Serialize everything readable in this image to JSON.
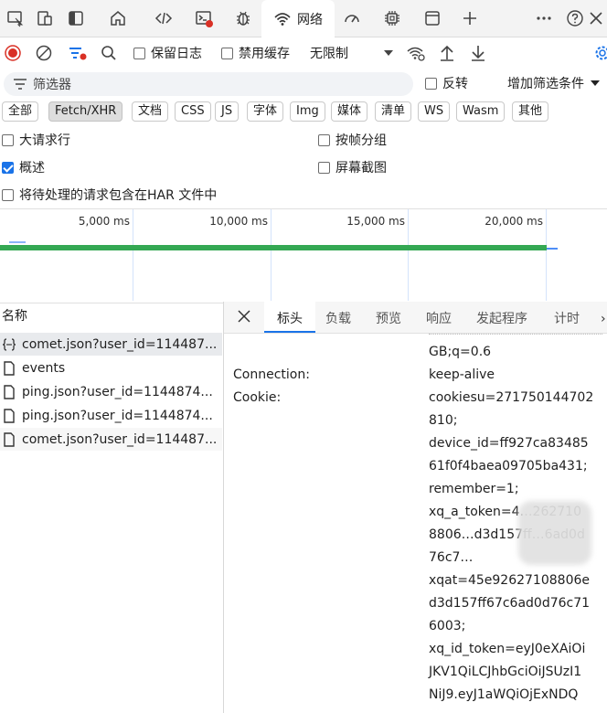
{
  "tabbar": {
    "network_label": "网络",
    "icons": [
      "inspect-icon",
      "device-emulation-icon",
      "sidebar-toggle-icon",
      "home-icon",
      "sources-icon",
      "console-icon",
      "debugger-icon",
      "network-icon",
      "performance-icon",
      "memory-icon",
      "application-icon",
      "add-tool-icon",
      "more-icon",
      "help-icon"
    ]
  },
  "toolbar": {
    "preserve_log": "保留日志",
    "disable_cache": "禁用缓存",
    "throttle": "无限制"
  },
  "filter": {
    "placeholder": "筛选器",
    "invert": "反转",
    "more_filters": "增加筛选条件"
  },
  "types": [
    "全部",
    "Fetch/XHR",
    "文档",
    "CSS",
    "JS",
    "字体",
    "Img",
    "媒体",
    "清单",
    "WS",
    "Wasm",
    "其他"
  ],
  "active_type": "Fetch/XHR",
  "options": {
    "big_rows": "大请求行",
    "group_by_frame": "按帧分组",
    "overview": "概述",
    "screenshots": "屏幕截图",
    "har_include": "将待处理的请求包含在HAR 文件中"
  },
  "timeline": {
    "ticks": [
      "5,000 ms",
      "10,000 ms",
      "15,000 ms",
      "20,000 ms"
    ]
  },
  "requests": {
    "header": "名称",
    "items": [
      {
        "name": "comet.json?user_id=114487...",
        "icon": "fetch-icon"
      },
      {
        "name": "events",
        "icon": "document-icon"
      },
      {
        "name": "ping.json?user_id=1144874...",
        "icon": "document-icon"
      },
      {
        "name": "ping.json?user_id=1144874...",
        "icon": "document-icon"
      },
      {
        "name": "comet.json?user_id=114487...",
        "icon": "document-icon"
      }
    ]
  },
  "details": {
    "tabs": [
      "标头",
      "负载",
      "预览",
      "响应",
      "发起程序",
      "计时"
    ],
    "active_tab": "标头",
    "partial_top_line": "GB;q=0.6",
    "headers": [
      {
        "name": "Connection:",
        "value_lines": [
          "keep-alive"
        ]
      },
      {
        "name": "Cookie:",
        "value_lines": [
          "cookiesu=271750144702",
          "810;",
          "device_id=ff927ca83485",
          "61f0f4baea09705ba431;",
          "remember=1;",
          "xq_a_token=4…262710",
          "8806…d3d157ff…6ad0d",
          "76c7…",
          "xqat=45e92627108806e",
          "d3d157ff67c6ad0d76c71",
          "6003;",
          "xq_id_token=eyJ0eXAiOi",
          "JKV1QiLCJhbGciOiJSUzI1",
          "NiJ9.eyJ1aWQiOjExNDQ"
        ]
      }
    ]
  },
  "colors": {
    "accent": "#1a73e8",
    "record_red": "#d93025",
    "timeline_bar": "#34a853"
  }
}
